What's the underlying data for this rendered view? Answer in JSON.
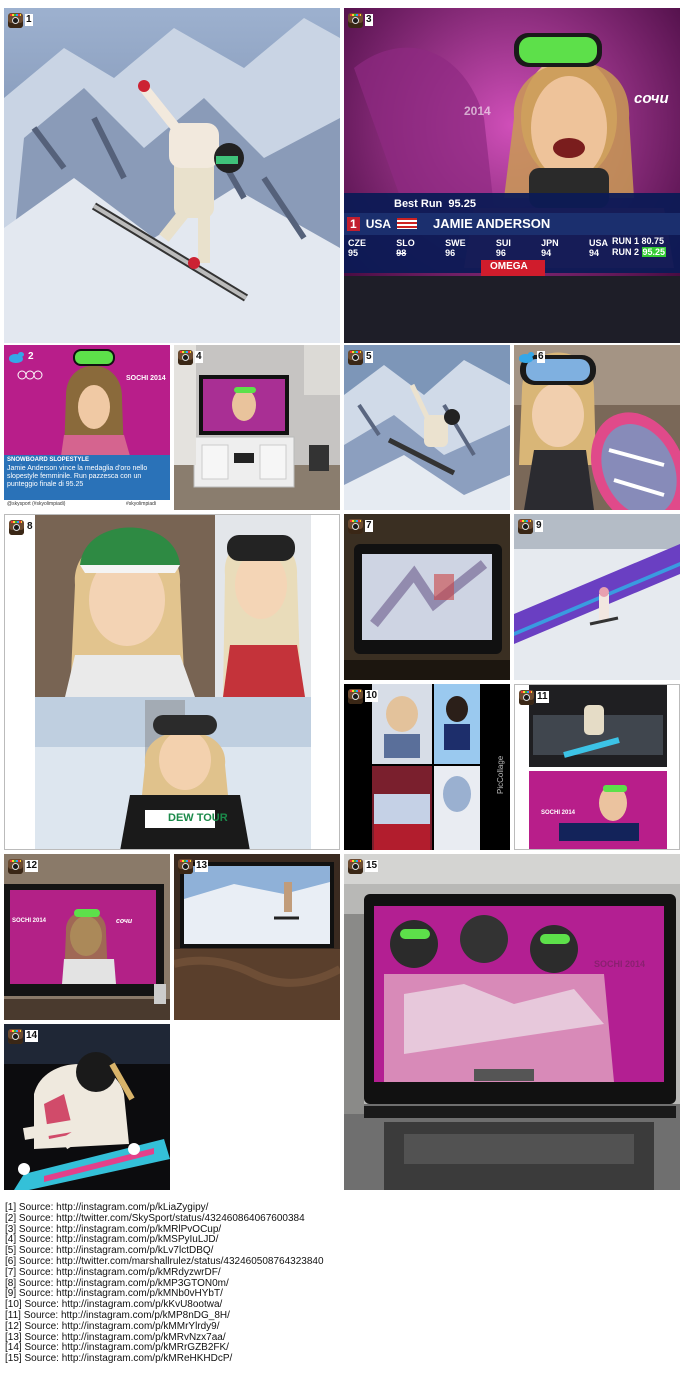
{
  "tiles": {
    "t1": {
      "num": "1",
      "source": "instagram",
      "icon": "camera-icon"
    },
    "t2": {
      "num": "2",
      "source": "twitter",
      "icon": "bird-icon",
      "headline": "SNOWBOARD SLOPESTYLE",
      "body": "Jamie Anderson vince la medaglia d'oro nello slopestyle femminile. Run pazzesca con un punteggio finale di 95.25",
      "footer_left": "@skysport (#skyolimpiadi)",
      "footer_right": "#skyolimpiadi",
      "tv": "SOCHI 2014"
    },
    "t3": {
      "num": "3",
      "source": "instagram",
      "icon": "camera-icon",
      "best_run_label": "Best Run",
      "best_run_value": "95.25",
      "rank": "1",
      "country": "USA",
      "athlete": "JAMIE ANDERSON",
      "scores": [
        {
          "c": "CZE",
          "v": "95"
        },
        {
          "c": "SLO",
          "v": "98"
        },
        {
          "c": "SWE",
          "v": "96"
        },
        {
          "c": "SUI",
          "v": "96"
        },
        {
          "c": "JPN",
          "v": "94"
        },
        {
          "c": "USA",
          "v": "94"
        }
      ],
      "run1_label": "RUN 1",
      "run1_value": "80.75",
      "run2_label": "RUN 2",
      "run2_value": "95.25",
      "sponsor": "OMEGA",
      "city": "сочи",
      "year": "2014"
    },
    "t4": {
      "num": "4",
      "source": "instagram",
      "icon": "camera-icon"
    },
    "t5": {
      "num": "5",
      "source": "instagram",
      "icon": "camera-icon"
    },
    "t6": {
      "num": "6",
      "source": "twitter",
      "icon": "bird-icon"
    },
    "t7": {
      "num": "7",
      "source": "instagram",
      "icon": "camera-icon"
    },
    "t8": {
      "num": "8",
      "source": "instagram",
      "icon": "camera-icon",
      "bib": "DEW TOUR"
    },
    "t9": {
      "num": "9",
      "source": "instagram",
      "icon": "camera-icon"
    },
    "t10": {
      "num": "10",
      "source": "instagram",
      "icon": "camera-icon",
      "watermark": "PicCollage"
    },
    "t11": {
      "num": "11",
      "source": "instagram",
      "icon": "camera-icon",
      "tv": "SOCHI 2014"
    },
    "t12": {
      "num": "12",
      "source": "instagram",
      "icon": "camera-icon",
      "tv": "SOCHI 2014",
      "tv2": "сочи"
    },
    "t13": {
      "num": "13",
      "source": "instagram",
      "icon": "camera-icon"
    },
    "t14": {
      "num": "14",
      "source": "instagram",
      "icon": "camera-icon"
    },
    "t15": {
      "num": "15",
      "source": "instagram",
      "icon": "camera-icon",
      "tv": "SOCHI 2014"
    }
  },
  "sources": [
    "[1] Source: http://instagram.com/p/kLiaZygipy/",
    "[2] Source: http://twitter.com/SkySport/status/432460864067600384",
    "[3] Source: http://instagram.com/p/kMRlPvOCup/",
    "[4] Source: http://instagram.com/p/kMSPyIuLJD/",
    "[5] Source: http://instagram.com/p/kLv7lctDBQ/",
    "[6] Source: http://twitter.com/marshallrulez/status/432460508764323840",
    "[7] Source: http://instagram.com/p/kMRdyzwrDF/",
    "[8] Source: http://instagram.com/p/kMP3GTON0m/",
    "[9] Source: http://instagram.com/p/kMNb0vHYbT/",
    "[10] Source: http://instagram.com/p/kKvU8ootwa/",
    "[11] Source: http://instagram.com/p/kMP8nDG_8H/",
    "[12] Source: http://instagram.com/p/kMMrYlrdy9/",
    "[13] Source: http://instagram.com/p/kMRvNzx7aa/",
    "[14] Source: http://instagram.com/p/kMRrGZB2FK/",
    "[15] Source: http://instagram.com/p/kMReHKHDcP/"
  ],
  "colors": {
    "olympic_pink": "#b81e8a",
    "snow_blue": "#7d96b8",
    "tv_bar": "#1b2f6e"
  }
}
